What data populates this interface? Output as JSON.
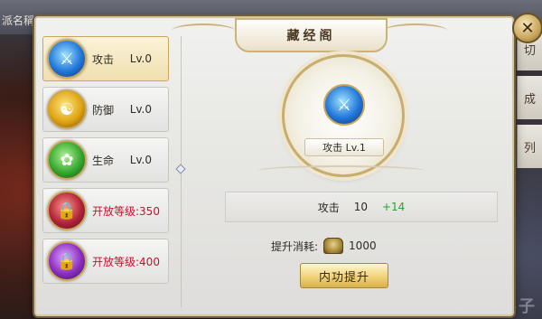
{
  "background": {
    "top_left_text": "派名稱",
    "right_tabs": [
      "切",
      "成",
      "列"
    ],
    "watermark": "游戏鸭子"
  },
  "panel": {
    "title": "藏经阁",
    "close_icon": "close-icon"
  },
  "skills": [
    {
      "name": "攻击",
      "level": "Lv.0",
      "icon": "attack-icon",
      "selected": true
    },
    {
      "name": "防御",
      "level": "Lv.0",
      "icon": "defense-icon",
      "selected": false
    },
    {
      "name": "生命",
      "level": "Lv.0",
      "icon": "life-icon",
      "selected": false
    },
    {
      "locked_text": "开放等级:350",
      "icon": "lock-icon"
    },
    {
      "locked_text": "开放等级:400",
      "icon": "lock-icon"
    }
  ],
  "detail": {
    "orb_label": "攻击  Lv.1",
    "stat": {
      "name": "攻击",
      "value": "10",
      "bonus": "+14"
    },
    "cost": {
      "label": "提升消耗:",
      "value": "1000",
      "icon": "coin-icon"
    },
    "upgrade_button": "内功提升"
  },
  "colors": {
    "locked_text": "#c8102e",
    "bonus_text": "#2aa52a",
    "gold_border": "#c9ad6c"
  }
}
